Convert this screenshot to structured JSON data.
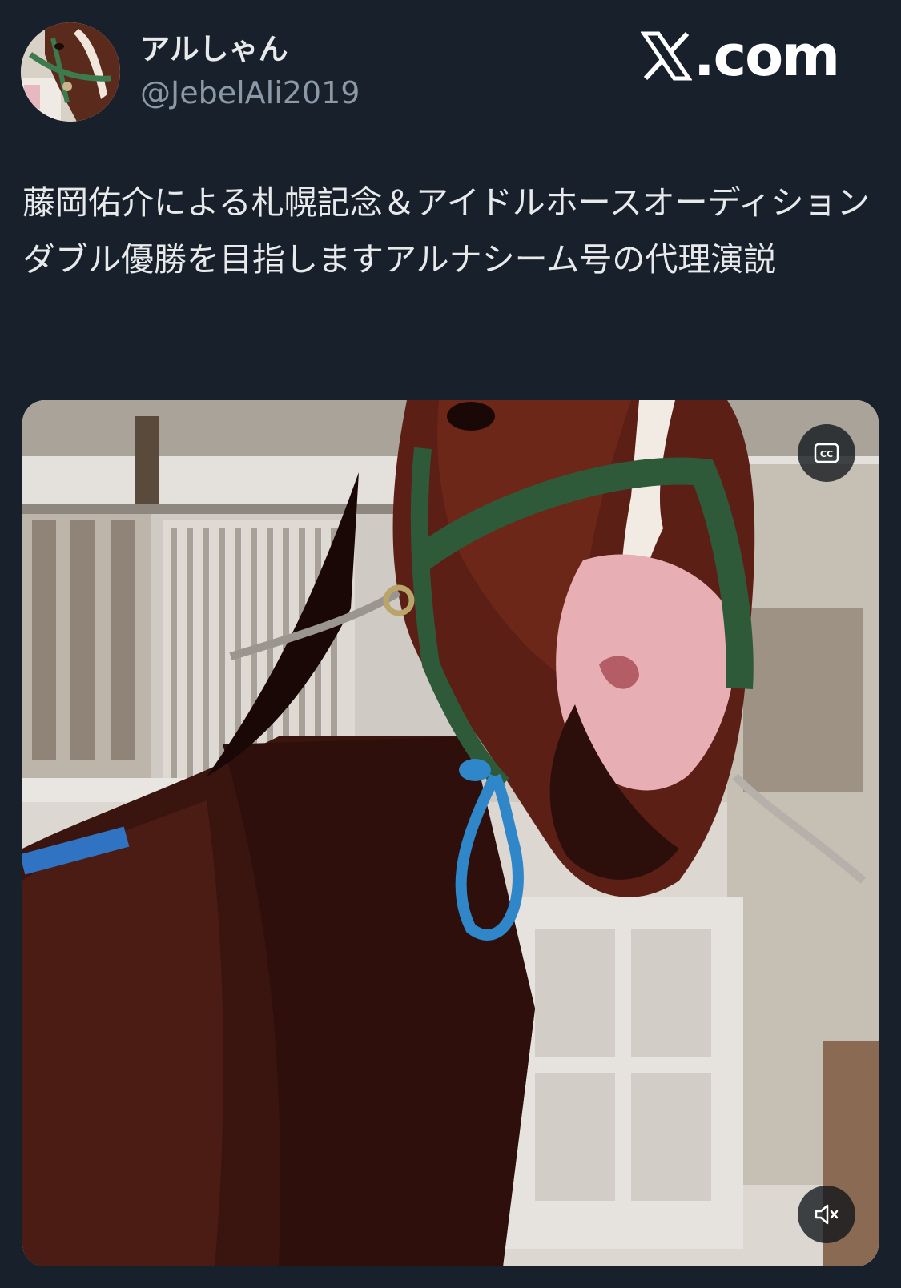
{
  "post": {
    "author": {
      "display_name": "アルしゃん",
      "handle": "@JebelAli2019",
      "avatar_icon": "horse-avatar-icon"
    },
    "brand": {
      "logo_icon": "x-logo-icon",
      "text": ".com"
    },
    "text": "藤岡佑介による札幌記念＆アイドルホースオーディションダブル優勝を目指しますアルナシーム号の代理演説"
  },
  "video": {
    "content": "horse-photo",
    "captions_icon": "captions-icon",
    "mute_icon": "speaker-muted-icon"
  },
  "colors": {
    "background": "#17202b",
    "text_primary": "#e7e9ea",
    "text_secondary": "#8b98a5",
    "halter_green": "#2f5a3a",
    "lead_blue": "#2f86c8"
  }
}
